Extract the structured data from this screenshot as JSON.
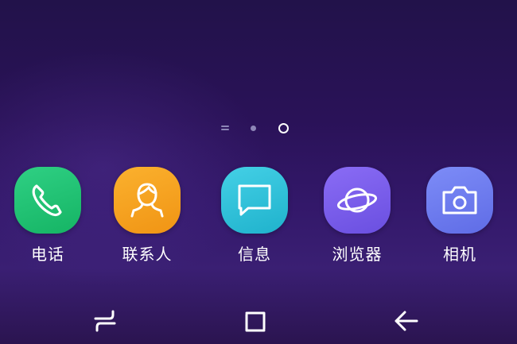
{
  "colors": {
    "phone": "#22c476",
    "contacts": "#f6a21e",
    "messages": "#2ec3d9",
    "browser": "#7c5df0",
    "camera": "#6d7cf2"
  },
  "page_indicator": {
    "pages": [
      "home-lines",
      "dot",
      "ring"
    ],
    "active_index": 2
  },
  "dock": {
    "apps": [
      {
        "label": "电话",
        "icon": "phone-icon"
      },
      {
        "label": "联系人",
        "icon": "contacts-icon"
      },
      {
        "label": "信息",
        "icon": "messages-icon"
      },
      {
        "label": "浏览器",
        "icon": "browser-icon"
      },
      {
        "label": "相机",
        "icon": "camera-icon"
      }
    ]
  },
  "navigation": {
    "buttons": [
      "recent-apps-icon",
      "home-icon",
      "back-icon"
    ]
  }
}
